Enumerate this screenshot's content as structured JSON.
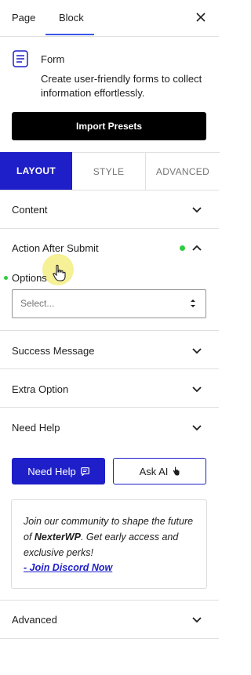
{
  "top_tabs": {
    "page": "Page",
    "block": "Block"
  },
  "block": {
    "name": "Form",
    "description": "Create user-friendly forms to collect information effortlessly.",
    "import_label": "Import Presets"
  },
  "panel_tabs": {
    "layout": "LAYOUT",
    "style": "STYLE",
    "advanced": "ADVANCED"
  },
  "sections": {
    "content": "Content",
    "action_after_submit": "Action After Submit",
    "options_label": "Options",
    "options_placeholder": "Select...",
    "success_message": "Success Message",
    "extra_option": "Extra Option",
    "need_help": "Need Help",
    "advanced": "Advanced"
  },
  "help": {
    "need_help_button": "Need Help",
    "ask_ai_button": "Ask AI",
    "community_pre": "Join our community to shape the future of ",
    "community_brand": "NexterWP",
    "community_post": ". Get early access and exclusive perks!",
    "discord_link": "- Join Discord Now"
  },
  "colors": {
    "accent": "#1f1fc9",
    "status_dot": "#2ecc40",
    "tab_underline": "#3858e9"
  }
}
